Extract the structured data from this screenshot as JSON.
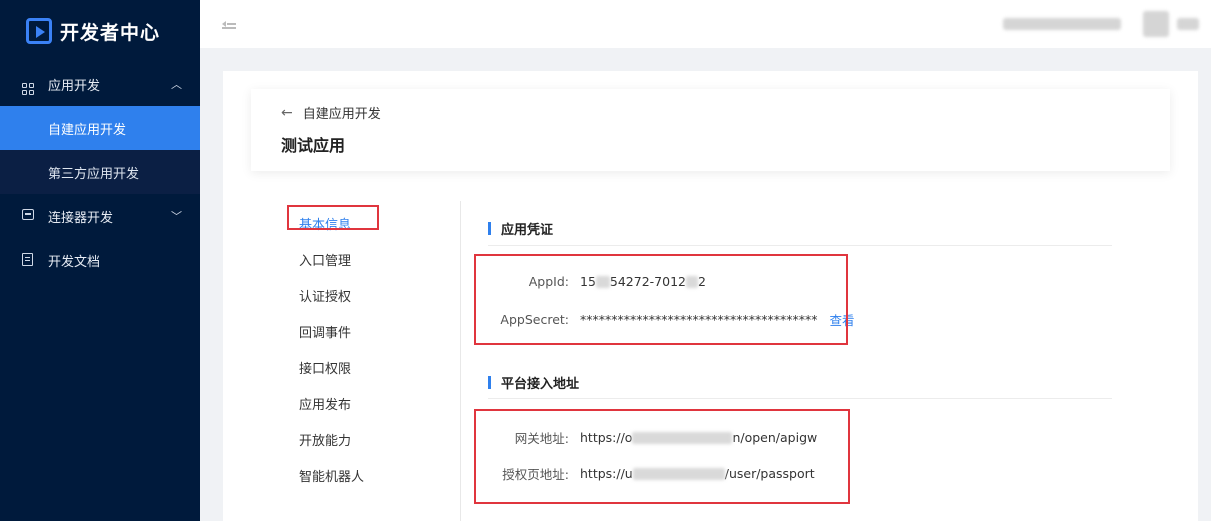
{
  "sidebar": {
    "logo_text": "开发者中心",
    "groups": [
      {
        "label": "应用开发",
        "icon": "grid-icon",
        "expanded": true,
        "children": [
          {
            "label": "自建应用开发",
            "active": true
          },
          {
            "label": "第三方应用开发",
            "active": false
          }
        ]
      },
      {
        "label": "连接器开发",
        "icon": "connector-icon",
        "expanded": false
      },
      {
        "label": "开发文档",
        "icon": "document-icon"
      }
    ]
  },
  "topbar": {
    "collapse_icon": "menu-fold-icon"
  },
  "header": {
    "back_label": "自建应用开发",
    "title": "测试应用"
  },
  "side_menu": {
    "items": [
      "基本信息",
      "入口管理",
      "认证授权",
      "回调事件",
      "接口权限",
      "应用发布",
      "开放能力",
      "智能机器人"
    ]
  },
  "credentials": {
    "title": "应用凭证",
    "appid_label": "AppId:",
    "appid_prefix": "15",
    "appid_mid": "54272-7012",
    "appid_suffix": "2",
    "secret_label": "AppSecret:",
    "secret_value": "**************************************",
    "view_label": "查看"
  },
  "platform": {
    "title": "平台接入地址",
    "gateway_label": "网关地址:",
    "gateway_prefix": "https://o",
    "gateway_suffix": "n/open/apigw",
    "auth_label": "授权页地址:",
    "auth_prefix": "https://u",
    "auth_suffix": "/user/passport"
  },
  "colors": {
    "sidebar_bg": "#001a3c",
    "accent": "#2f80ed",
    "highlight_red": "#e0353e"
  }
}
